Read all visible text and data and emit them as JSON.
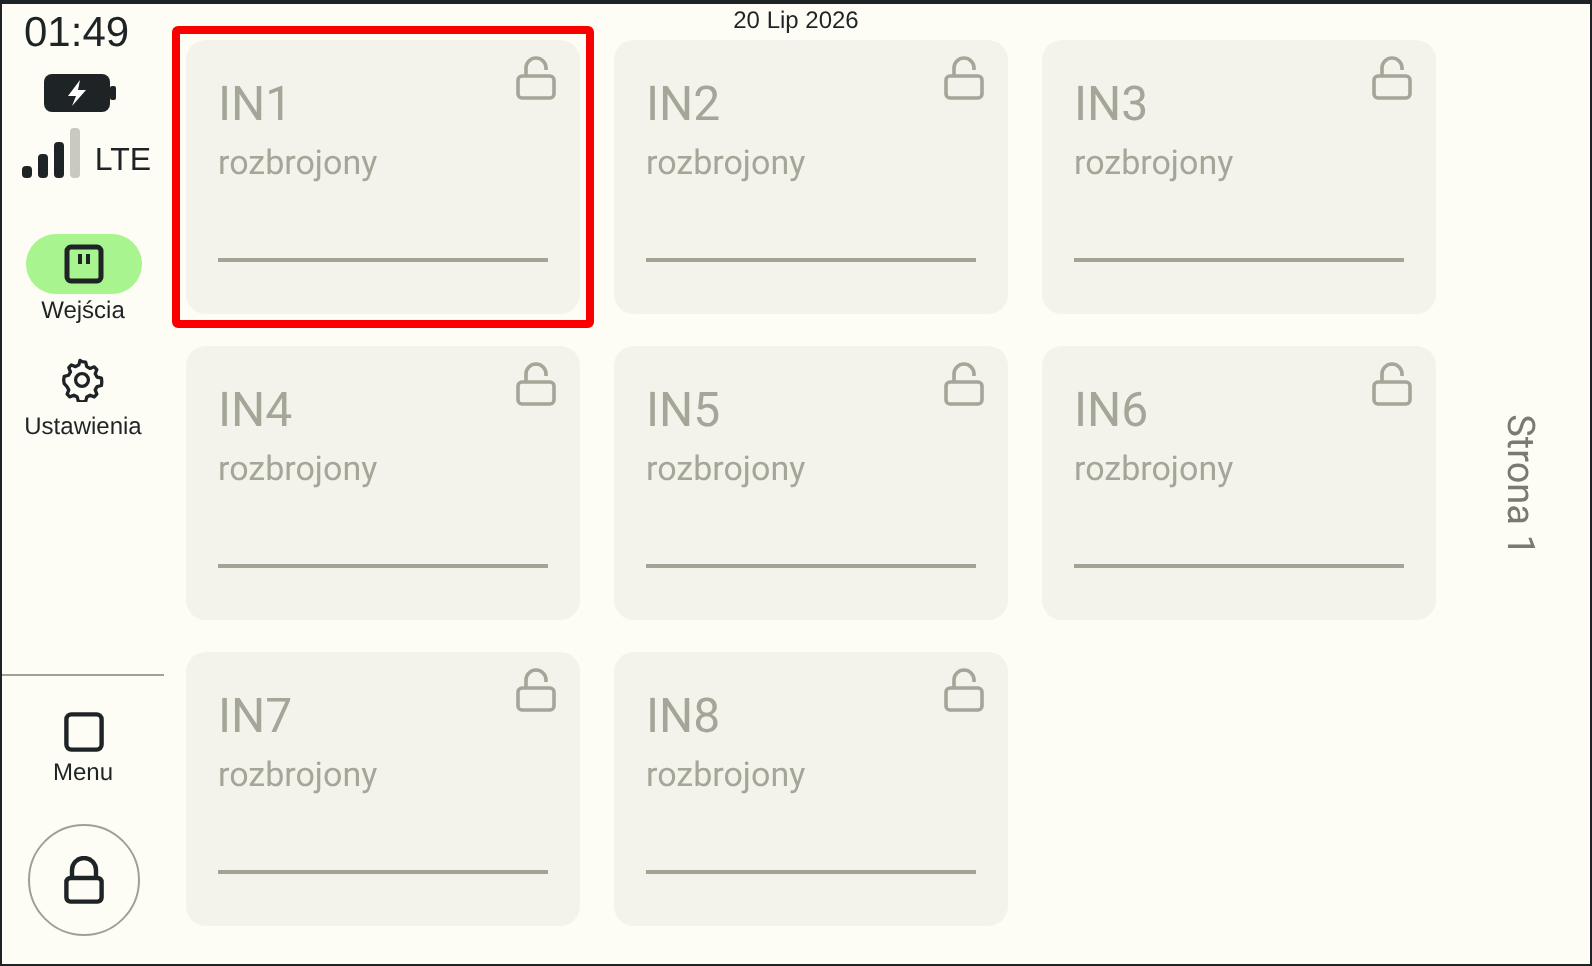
{
  "status": {
    "time": "01:49",
    "network": "LTE",
    "date": "20 Lip 2026"
  },
  "nav": [
    {
      "label": "Wejścia",
      "kind": "inputs",
      "selected": true
    },
    {
      "label": "Ustawienia",
      "kind": "settings",
      "selected": false
    }
  ],
  "menu": {
    "label": "Menu"
  },
  "inputs": [
    {
      "name": "IN1",
      "state": "rozbrojony",
      "selected": true
    },
    {
      "name": "IN2",
      "state": "rozbrojony",
      "selected": false
    },
    {
      "name": "IN3",
      "state": "rozbrojony",
      "selected": false
    },
    {
      "name": "IN4",
      "state": "rozbrojony",
      "selected": false
    },
    {
      "name": "IN5",
      "state": "rozbrojony",
      "selected": false
    },
    {
      "name": "IN6",
      "state": "rozbrojony",
      "selected": false
    },
    {
      "name": "IN7",
      "state": "rozbrojony",
      "selected": false
    },
    {
      "name": "IN8",
      "state": "rozbrojony",
      "selected": false
    }
  ],
  "page": {
    "label": "Strona 1"
  }
}
